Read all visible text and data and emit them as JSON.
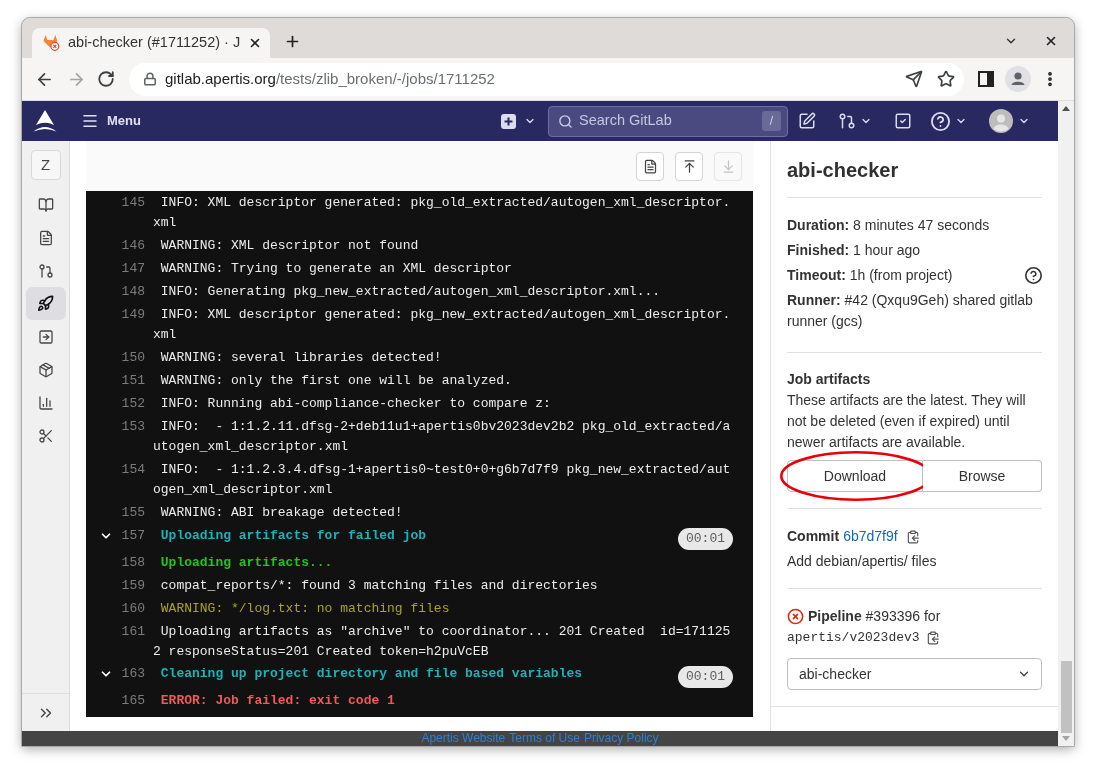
{
  "browser": {
    "tab": {
      "title": "abi-checker (#1711252) · J"
    },
    "address": {
      "host": "gitlab.apertis.org",
      "path": "/tests/zlib_broken/-/jobs/1711252"
    }
  },
  "navbar": {
    "menu_label": "Menu",
    "search": {
      "placeholder": "Search GitLab",
      "shortcut": "/"
    }
  },
  "sidebar": {
    "project_avatar": "Z",
    "items": [
      {
        "selected": false
      },
      {
        "selected": false
      },
      {
        "selected": false
      },
      {
        "selected": true
      },
      {
        "selected": false
      },
      {
        "selected": false
      },
      {
        "selected": false
      },
      {
        "selected": false
      }
    ]
  },
  "log_toolbar": {
    "buttons": [
      {
        "disabled": false
      },
      {
        "disabled": false
      },
      {
        "disabled": true
      }
    ]
  },
  "log": {
    "lines": [
      {
        "number": "145",
        "kind": "plain",
        "text": "INFO: XML descriptor generated: pkg_old_extracted/autogen_xml_descriptor.xml"
      },
      {
        "number": "146",
        "kind": "plain",
        "text": "WARNING: XML descriptor not found"
      },
      {
        "number": "147",
        "kind": "plain",
        "text": "WARNING: Trying to generate an XML descriptor"
      },
      {
        "number": "148",
        "kind": "plain",
        "text": "INFO: Generating pkg_new_extracted/autogen_xml_descriptor.xml..."
      },
      {
        "number": "149",
        "kind": "plain",
        "text": "INFO: XML descriptor generated: pkg_new_extracted/autogen_xml_descriptor.xml"
      },
      {
        "number": "150",
        "kind": "plain",
        "text": "WARNING: several libraries detected!"
      },
      {
        "number": "151",
        "kind": "plain",
        "text": "WARNING: only the first one will be analyzed."
      },
      {
        "number": "152",
        "kind": "plain",
        "text": "INFO: Running abi-compliance-checker to compare z:"
      },
      {
        "number": "153",
        "kind": "plain",
        "text": "INFO:  - 1:1.2.11.dfsg-2+deb11u1+apertis0bv2023dev2b2 pkg_old_extracted/autogen_xml_descriptor.xml"
      },
      {
        "number": "154",
        "kind": "plain",
        "text": "INFO:  - 1:1.2.3.4.dfsg-1+apertis0~test0+0+g6b7d7f9 pkg_new_extracted/autogen_xml_descriptor.xml"
      },
      {
        "number": "155",
        "kind": "plain",
        "text": "WARNING: ABI breakage detected!"
      },
      {
        "number": "157",
        "kind": "section",
        "text": "Uploading artifacts for failed job",
        "expanded": true,
        "duration": "00:01"
      },
      {
        "number": "158",
        "kind": "success",
        "text": "Uploading artifacts..."
      },
      {
        "number": "159",
        "kind": "plain",
        "text": "compat_reports/*: found 3 matching files and directories"
      },
      {
        "number": "160",
        "kind": "warning",
        "text": "WARNING: */log.txt: no matching files"
      },
      {
        "number": "161",
        "kind": "plain",
        "text": "Uploading artifacts as \"archive\" to coordinator... 201 Created  id=1711252 responseStatus=201 Created token=h2puVcEB"
      },
      {
        "number": "163",
        "kind": "section",
        "text": "Cleaning up project directory and file based variables",
        "expanded": true,
        "duration": "00:01"
      },
      {
        "number": "165",
        "kind": "error",
        "text": "ERROR: Job failed: exit code 1"
      }
    ]
  },
  "job": {
    "title": "abi-checker",
    "details": [
      {
        "text": "**Duration:** 8 minutes 47 seconds"
      },
      {
        "text": "**Finished:** 1 hour ago"
      },
      {
        "text": "**Timeout:** 1h (from project)",
        "help": true
      },
      {
        "text": "**Runner:** #42 (Qxqu9Geh) shared gitlab runner (gcs)"
      }
    ],
    "artifacts": {
      "heading": "Job artifacts",
      "text": "These artifacts are the latest. They will not be deleted (even if expired) until newer artifacts are available.",
      "buttons": [
        {
          "label": "Download",
          "highlighted": true
        },
        {
          "label": "Browse",
          "highlighted": false
        }
      ]
    },
    "commit": {
      "label": "Commit",
      "sha": "6b7d7f9f",
      "message": "Add debian/apertis/ files"
    },
    "pipeline": {
      "failed": true,
      "text": "**Pipeline** #393396 for",
      "branch": "apertis/v2023dev3",
      "job_select": "abi-checker"
    }
  },
  "footer": {
    "links": [
      "Apertis Website",
      "Terms of Use",
      "Privacy Policy"
    ]
  }
}
